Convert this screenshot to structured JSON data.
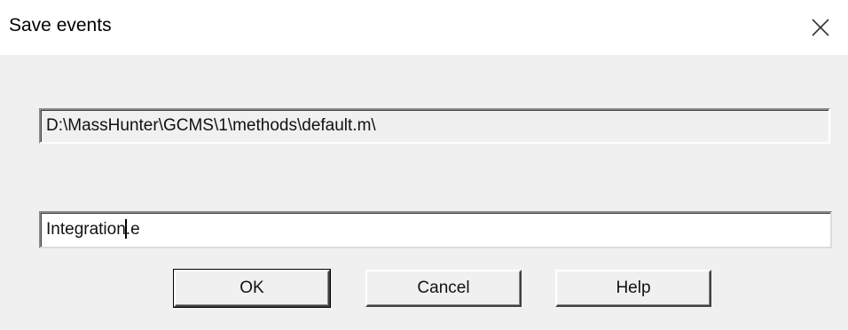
{
  "window": {
    "title": "Save events",
    "close_icon": "close-icon"
  },
  "path_field": {
    "value": "D:\\MassHunter\\GCMS\\1\\methods\\default.m\\"
  },
  "name_field": {
    "value_before_caret": "Integration",
    "value_after_caret": ".e"
  },
  "buttons": {
    "ok": "OK",
    "cancel": "Cancel",
    "help": "Help"
  }
}
